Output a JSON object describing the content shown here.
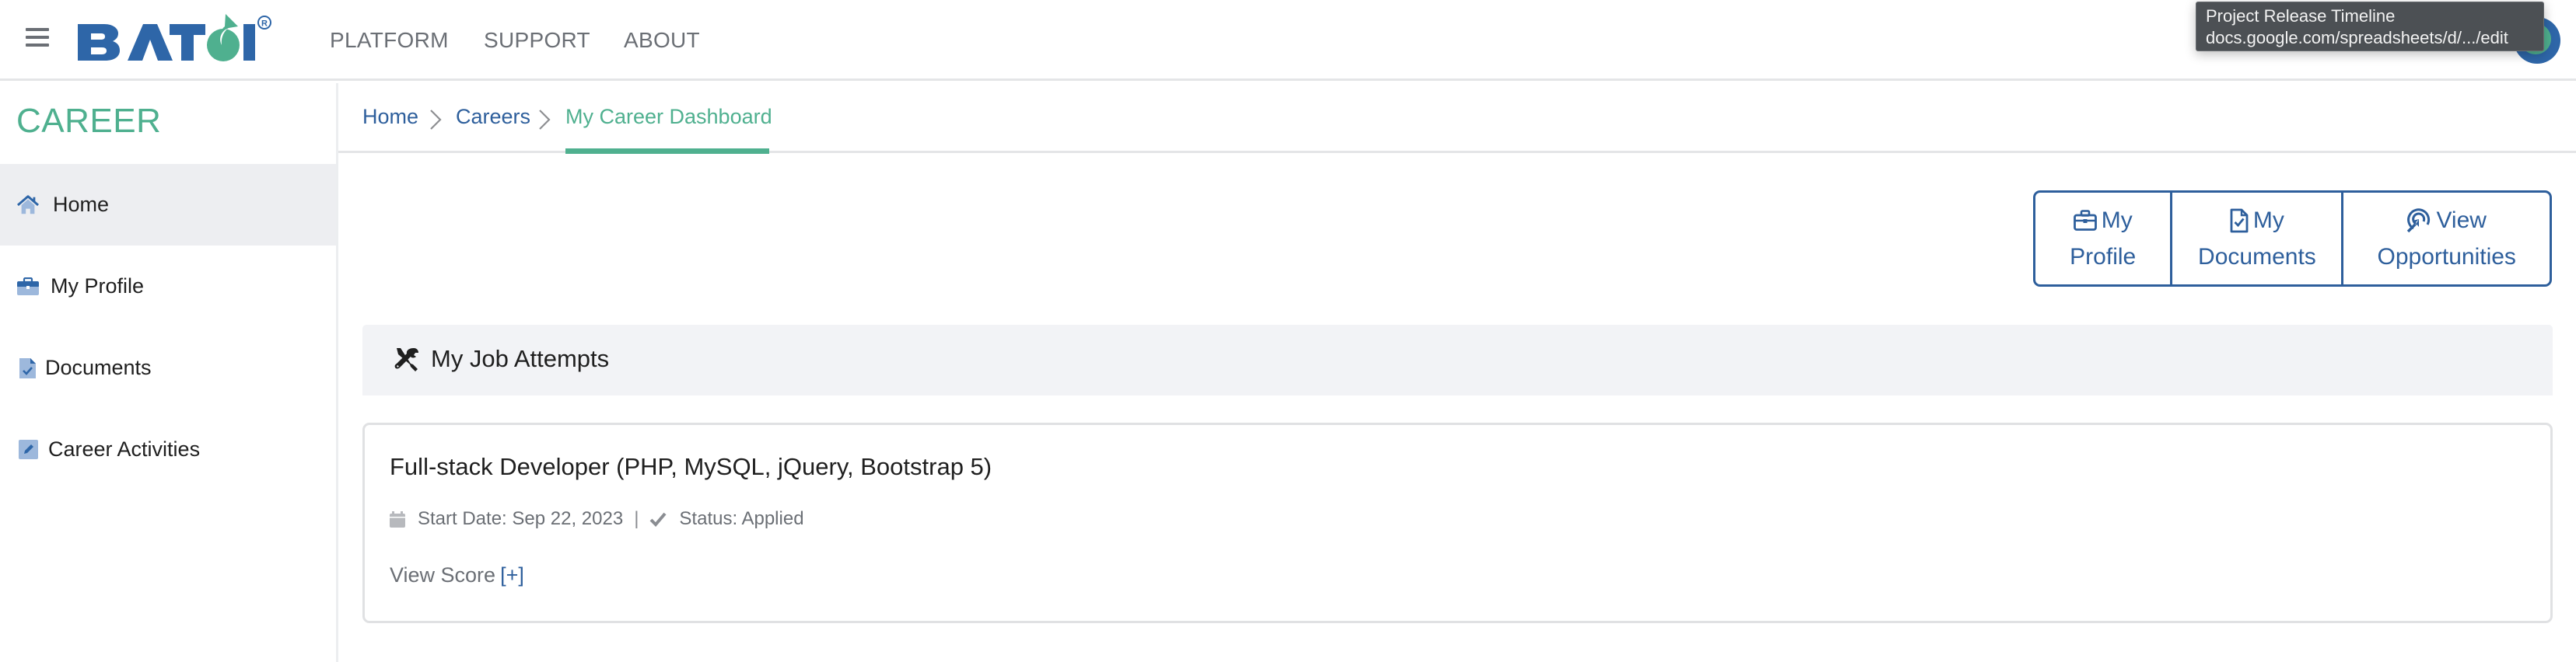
{
  "header": {
    "brand": "BATOI",
    "nav": [
      {
        "label": "PLATFORM"
      },
      {
        "label": "SUPPORT"
      },
      {
        "label": "ABOUT"
      }
    ],
    "tooltip": {
      "title": "Project Release Timeline",
      "url": "docs.google.com/spreadsheets/d/.../edit"
    }
  },
  "sidebar": {
    "title": "CAREER",
    "items": [
      {
        "label": "Home",
        "icon": "home-icon",
        "active": true
      },
      {
        "label": "My Profile",
        "icon": "briefcase-icon"
      },
      {
        "label": "Documents",
        "icon": "document-check-icon"
      },
      {
        "label": "Career Activities",
        "icon": "pencil-square-icon"
      }
    ]
  },
  "breadcrumb": {
    "items": [
      {
        "label": "Home"
      },
      {
        "label": "Careers"
      },
      {
        "label": "My Career Dashboard",
        "current": true
      }
    ]
  },
  "actions": {
    "buttons": [
      {
        "line1": "My",
        "line2": "Profile",
        "icon": "briefcase-icon"
      },
      {
        "line1": "My",
        "line2": "Documents",
        "icon": "file-check-icon"
      },
      {
        "line1": "View",
        "line2": "Opportunities",
        "icon": "target-arrow-icon"
      }
    ]
  },
  "job_attempts": {
    "title": "My Job Attempts",
    "jobs": [
      {
        "title": "Full-stack Developer (PHP, MySQL, jQuery, Bootstrap 5)",
        "start_date": "Start Date: Sep 22, 2023",
        "separator": "|",
        "status": "Status: Applied",
        "view_score_label": "View Score",
        "view_score_toggle": "[+]"
      }
    ]
  },
  "colors": {
    "brand_blue": "#2e66a8",
    "link_blue": "#2e5f9c",
    "accent_green": "#4fb08f",
    "nav_gray": "#6b6f75",
    "active_bg": "#edeef1",
    "section_bg": "#f2f3f6"
  }
}
